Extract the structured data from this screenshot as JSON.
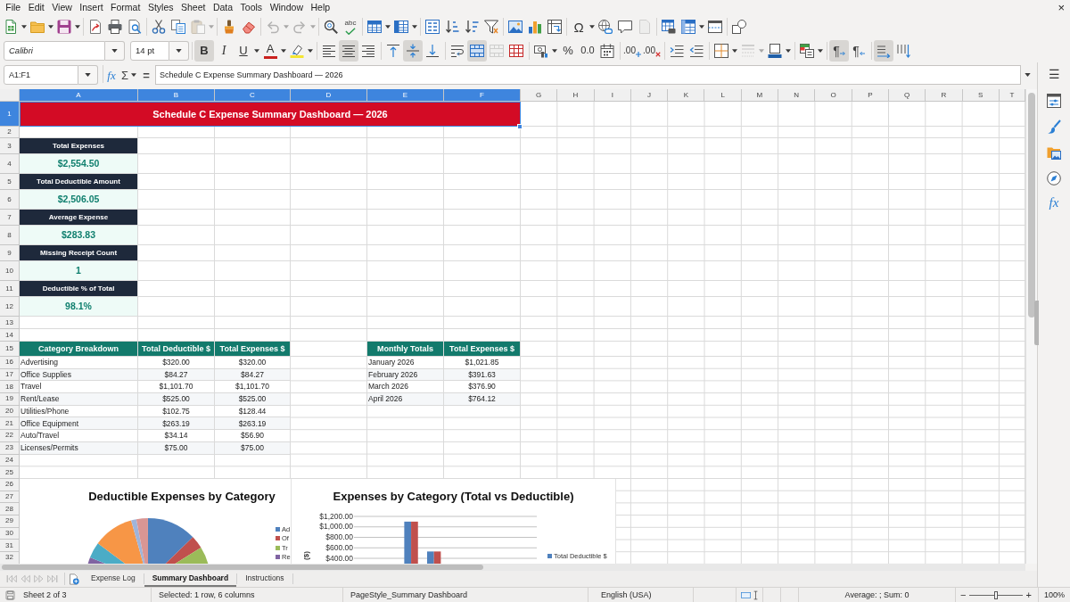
{
  "menu": [
    "File",
    "Edit",
    "View",
    "Insert",
    "Format",
    "Styles",
    "Sheet",
    "Data",
    "Tools",
    "Window",
    "Help"
  ],
  "window": {
    "close": "×"
  },
  "standard_toolbar": {
    "paste": {
      "disabled": true
    },
    "undo": {
      "disabled": true
    },
    "redo": {
      "disabled": true
    },
    "spelling": "abc",
    "special_character": "Ω",
    "header_footer": {
      "disabled": true
    }
  },
  "formatting_toolbar": {
    "font_name": "Calibri",
    "font_size": "14 pt",
    "bold": {
      "label": "B",
      "on": true
    },
    "italic": {
      "label": "I",
      "on": false
    },
    "underline": {
      "label": "U",
      "on": false
    },
    "font_color": "A",
    "align_left": {
      "on": false
    },
    "align_center": {
      "on": true
    },
    "align_right": {
      "on": false
    },
    "align_top": {
      "on": false
    },
    "align_middle": {
      "on": true
    },
    "align_bottom": {
      "on": false
    },
    "wrap_text": {
      "on": false
    },
    "merge_and_center": {
      "on": true
    },
    "merge_cells": {
      "disabled": true
    },
    "percent": "%",
    "standard_format": "0.0",
    "add_decimal": ".00",
    "delete_decimal": ".00",
    "border_style": {
      "disabled": true
    },
    "left_to_right": {
      "label": "¶",
      "on": true
    },
    "right_to_left": {
      "label": "¶",
      "on": false
    },
    "text_left_to_right": {
      "on": true
    },
    "text_top_to_bottom": {
      "on": false
    }
  },
  "formula_bar": {
    "name_box": "A1:F1",
    "function_wizard": "fx",
    "sum": "Σ",
    "equals": "=",
    "formula": "Schedule C Expense Summary Dashboard — 2026"
  },
  "sidebar": {
    "menu": "☰",
    "functions": "fx"
  },
  "sheet": {
    "columns": [
      {
        "label": "A",
        "selected": true
      },
      {
        "label": "B",
        "selected": true
      },
      {
        "label": "C",
        "selected": true
      },
      {
        "label": "D",
        "selected": true
      },
      {
        "label": "E",
        "selected": true
      },
      {
        "label": "F",
        "selected": true
      },
      {
        "label": "G",
        "selected": false
      },
      {
        "label": "H",
        "selected": false
      },
      {
        "label": "I",
        "selected": false
      },
      {
        "label": "J",
        "selected": false
      },
      {
        "label": "K",
        "selected": false
      },
      {
        "label": "L",
        "selected": false
      },
      {
        "label": "M",
        "selected": false
      },
      {
        "label": "N",
        "selected": false
      },
      {
        "label": "O",
        "selected": false
      },
      {
        "label": "P",
        "selected": false
      },
      {
        "label": "Q",
        "selected": false
      },
      {
        "label": "R",
        "selected": false
      },
      {
        "label": "S",
        "selected": false
      },
      {
        "label": "T",
        "selected": false
      }
    ],
    "rows": [
      {
        "label": "1",
        "selected": true
      },
      {
        "label": "2",
        "selected": false
      },
      {
        "label": "3",
        "selected": false
      },
      {
        "label": "4",
        "selected": false
      },
      {
        "label": "5",
        "selected": false
      },
      {
        "label": "6",
        "selected": false
      },
      {
        "label": "7",
        "selected": false
      },
      {
        "label": "8",
        "selected": false
      },
      {
        "label": "9",
        "selected": false
      },
      {
        "label": "10",
        "selected": false
      },
      {
        "label": "11",
        "selected": false
      },
      {
        "label": "12",
        "selected": false
      },
      {
        "label": "13",
        "selected": false
      },
      {
        "label": "14",
        "selected": false
      },
      {
        "label": "15",
        "selected": false
      },
      {
        "label": "16",
        "selected": false
      },
      {
        "label": "17",
        "selected": false
      },
      {
        "label": "18",
        "selected": false
      },
      {
        "label": "19",
        "selected": false
      },
      {
        "label": "20",
        "selected": false
      },
      {
        "label": "21",
        "selected": false
      },
      {
        "label": "22",
        "selected": false
      },
      {
        "label": "23",
        "selected": false
      },
      {
        "label": "24",
        "selected": false
      },
      {
        "label": "25",
        "selected": false
      },
      {
        "label": "26",
        "selected": false
      },
      {
        "label": "27",
        "selected": false
      },
      {
        "label": "28",
        "selected": false
      },
      {
        "label": "29",
        "selected": false
      },
      {
        "label": "30",
        "selected": false
      },
      {
        "label": "31",
        "selected": false
      },
      {
        "label": "32",
        "selected": false
      }
    ],
    "title": "Schedule C Expense Summary Dashboard — 2026",
    "kpis": [
      {
        "label": "Total Expenses",
        "value": "$2,554.50"
      },
      {
        "label": "Total Deductible Amount",
        "value": "$2,506.05"
      },
      {
        "label": "Average Expense",
        "value": "$283.83"
      },
      {
        "label": "Missing Receipt Count",
        "value": "1"
      },
      {
        "label": "Deductible % of Total",
        "value": "98.1%"
      }
    ],
    "category_table": {
      "columns": [
        "Category Breakdown",
        "Total Deductible $",
        "Total Expenses $"
      ],
      "rows": [
        [
          "Advertising",
          "$320.00",
          "$320.00"
        ],
        [
          "Office Supplies",
          "$84.27",
          "$84.27"
        ],
        [
          "Travel",
          "$1,101.70",
          "$1,101.70"
        ],
        [
          "Rent/Lease",
          "$525.00",
          "$525.00"
        ],
        [
          "Utilities/Phone",
          "$102.75",
          "$128.44"
        ],
        [
          "Office Equipment",
          "$263.19",
          "$263.19"
        ],
        [
          "Auto/Travel",
          "$34.14",
          "$56.90"
        ],
        [
          "Licenses/Permits",
          "$75.00",
          "$75.00"
        ]
      ]
    },
    "monthly_table": {
      "columns": [
        "Monthly Totals",
        "Total Expenses $"
      ],
      "rows": [
        [
          "January 2026",
          "$1,021.85"
        ],
        [
          "February 2026",
          "$391.63"
        ],
        [
          "March 2026",
          "$376.90"
        ],
        [
          "April 2026",
          "$764.12"
        ]
      ]
    }
  },
  "charts": {
    "pie": {
      "title": "Deductible Expenses by Category",
      "legend": [
        {
          "label": "Ad",
          "color": "#4f81bd"
        },
        {
          "label": "Of",
          "color": "#c0504d"
        },
        {
          "label": "Tr",
          "color": "#9bbb59"
        },
        {
          "label": "Re",
          "color": "#8064a2"
        }
      ]
    },
    "bar": {
      "chart_data": {
        "type": "bar",
        "title": "Expenses by Category (Total vs Deductible)",
        "ylabel": "($)",
        "ylim": [
          0,
          1200
        ],
        "yticks": [
          {
            "value": 400,
            "label": "$400.00"
          },
          {
            "value": 600,
            "label": "$600.00"
          },
          {
            "value": 800,
            "label": "$800.00"
          },
          {
            "value": 1000,
            "label": "$1,000.00"
          },
          {
            "value": 1200,
            "label": "$1,200.00"
          }
        ],
        "grid": true,
        "stacked": false,
        "series": [
          {
            "name": "Total Deductible $",
            "color": "#4f81bd",
            "values": [
              null,
              null,
              1100,
              530,
              null,
              null,
              null,
              null
            ]
          },
          {
            "color": "#c0504d",
            "values": [
              null,
              null,
              1100,
              530,
              null,
              null,
              null,
              null
            ]
          }
        ]
      }
    }
  },
  "sheet_tabs": [
    {
      "label": "Expense Log",
      "selected": false
    },
    {
      "label": "Summary Dashboard",
      "selected": true
    },
    {
      "label": "Instructions",
      "selected": false
    }
  ],
  "status_bar": {
    "sheet_position": "Sheet 2 of 3",
    "selection": "Selected: 1 row, 6 columns",
    "page_style": "PageStyle_Summary Dashboard",
    "language": "English (USA)",
    "summary": "Average: ; Sum: 0",
    "zoom_out": "−",
    "zoom_in": "+",
    "zoom": {
      "level": 0.5
    },
    "zoom_percent": "100%"
  }
}
